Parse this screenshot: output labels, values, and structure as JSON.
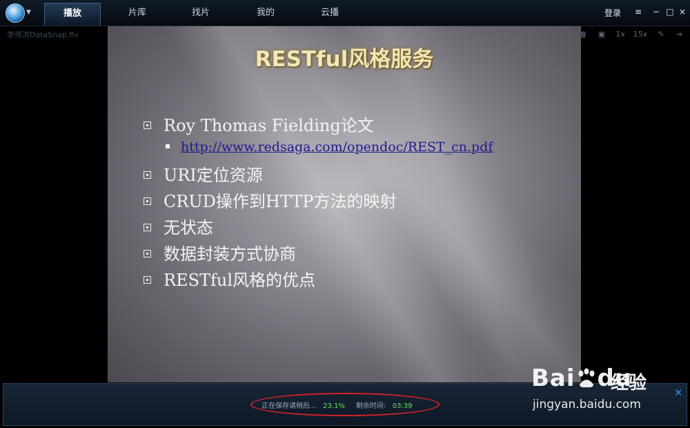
{
  "topbar": {
    "tabs": [
      {
        "label": "播放",
        "active": true
      },
      {
        "label": "片库",
        "active": false
      },
      {
        "label": "找片",
        "active": false
      },
      {
        "label": "我的",
        "active": false
      },
      {
        "label": "云播",
        "active": false
      }
    ],
    "login": "登录",
    "window_controls": {
      "menu": "≡",
      "minimize": "−",
      "maximize": "□",
      "close": "×"
    }
  },
  "toolbar": {
    "filename": "李伟洪DataSnap.flv",
    "speed_1x": "1x",
    "speed_15x": "15x"
  },
  "slide": {
    "title": "RESTful风格服务",
    "bullets": [
      "Roy Thomas Fielding论文",
      "URI定位资源",
      "CRUD操作到HTTP方法的映射",
      "无状态",
      "数据封装方式协商",
      "RESTful风格的优点"
    ],
    "sub_link": "http://www.redsaga.com/opendoc/REST_cn.pdf"
  },
  "save_status": {
    "label": "正在保存请稍后...",
    "percent": "23.1%",
    "remaining_label": "剩余时间:",
    "remaining_time": "03:39",
    "close": "✕"
  },
  "watermark": {
    "logo": "Bai",
    "logo_tail": "du",
    "cn": "经验",
    "url": "jingyan.baidu.com"
  },
  "colors": {
    "accent": "#2c8ee8",
    "highlight_oval": "#d8212a",
    "progress_text": "#6ee060",
    "title_gold": "#f1e6b8"
  }
}
